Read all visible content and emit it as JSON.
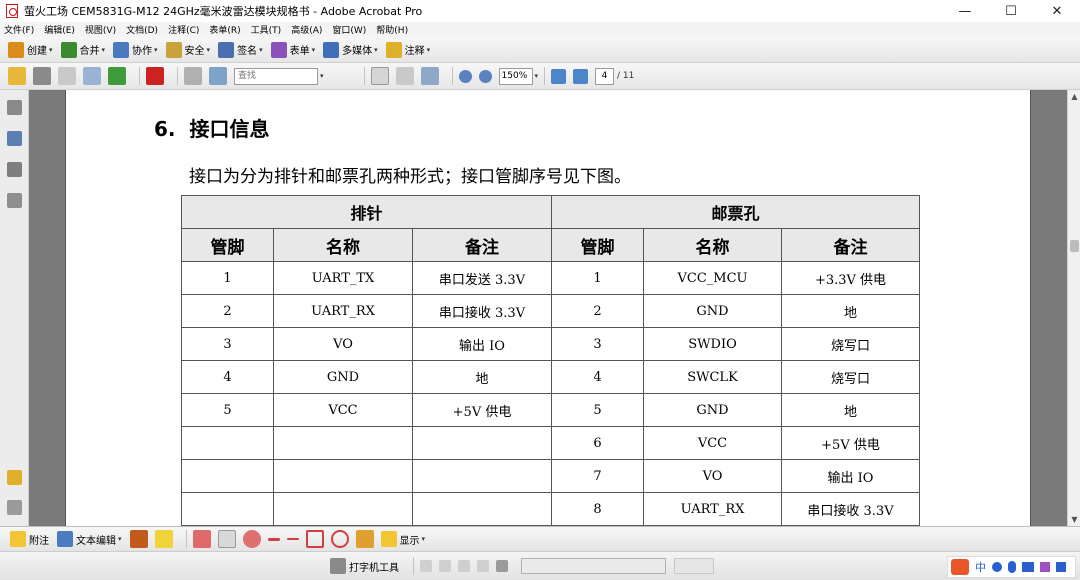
{
  "window": {
    "title": "萤火工场 CEM5831G-M12 24GHz毫米波雷达模块规格书 - Adobe Acrobat Pro",
    "controls": {
      "minimize": "—",
      "maximize": "☐",
      "close": "✕"
    }
  },
  "menu": [
    "文件(F)",
    "编辑(E)",
    "视图(V)",
    "文档(D)",
    "注释(C)",
    "表单(R)",
    "工具(T)",
    "高级(A)",
    "窗口(W)",
    "帮助(H)"
  ],
  "toolbar1": [
    {
      "label": "创建",
      "icon": "create-pdf-icon",
      "color": "#d98b1c"
    },
    {
      "label": "合并",
      "icon": "combine-icon",
      "color": "#3a8a2e"
    },
    {
      "label": "协作",
      "icon": "collaborate-icon",
      "color": "#4a79c0"
    },
    {
      "label": "安全",
      "icon": "lock-icon",
      "color": "#c8a23a"
    },
    {
      "label": "签名",
      "icon": "pen-sign-icon",
      "color": "#4a6fb0"
    },
    {
      "label": "表单",
      "icon": "form-icon",
      "color": "#8a52b8"
    },
    {
      "label": "多媒体",
      "icon": "multimedia-icon",
      "color": "#3f6fb8"
    },
    {
      "label": "注释",
      "icon": "comment-icon",
      "color": "#e0b02a"
    }
  ],
  "toolbar2": {
    "search_placeholder": "查找",
    "zoom": "150%",
    "current_page": "4",
    "total_pages": "/ 11"
  },
  "document": {
    "heading_number": "6.",
    "heading_text": "接口信息",
    "intro": "接口为分为排针和邮票孔两种形式；接口管脚序号见下图。",
    "groups": [
      "排针",
      "邮票孔"
    ],
    "columns": [
      "管脚",
      "名称",
      "备注",
      "管脚",
      "名称",
      "备注"
    ],
    "rows": [
      [
        "1",
        "UART_TX",
        "串口发送 3.3V",
        "1",
        "VCC_MCU",
        "+3.3V 供电"
      ],
      [
        "2",
        "UART_RX",
        "串口接收 3.3V",
        "2",
        "GND",
        "地"
      ],
      [
        "3",
        "VO",
        "输出 IO",
        "3",
        "SWDIO",
        "烧写口"
      ],
      [
        "4",
        "GND",
        "地",
        "4",
        "SWCLK",
        "烧写口"
      ],
      [
        "5",
        "VCC",
        "+5V 供电",
        "5",
        "GND",
        "地"
      ],
      [
        "",
        "",
        "",
        "6",
        "VCC",
        "+5V 供电"
      ],
      [
        "",
        "",
        "",
        "7",
        "VO",
        "输出 IO"
      ],
      [
        "",
        "",
        "",
        "8",
        "UART_RX",
        "串口接收 3.3V"
      ]
    ]
  },
  "comment_bar": {
    "sticky_note": "附注",
    "text_edit": "文本编辑",
    "show": "显示"
  },
  "typewriter_bar": {
    "typewriter": "打字机工具"
  },
  "ime": {
    "lang": "中"
  }
}
